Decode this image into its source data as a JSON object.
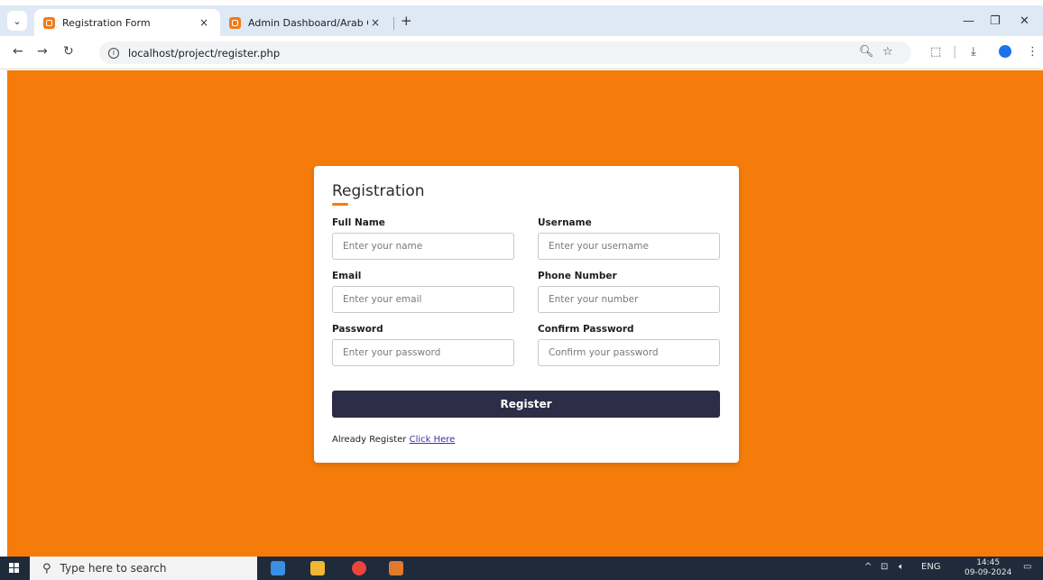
{
  "browser": {
    "tabs": [
      {
        "title": "Registration Form",
        "close": "×"
      },
      {
        "title": "Admin Dashboard/Arab Cars",
        "close": "×"
      }
    ],
    "new_tab": "+",
    "url": "localhost/project/register.php",
    "info_glyph": "i"
  },
  "form": {
    "title": "Registration",
    "fields": [
      {
        "label": "Full Name",
        "placeholder": "Enter your name"
      },
      {
        "label": "Username",
        "placeholder": "Enter your username"
      },
      {
        "label": "Email",
        "placeholder": "Enter your email"
      },
      {
        "label": "Phone Number",
        "placeholder": "Enter your number"
      },
      {
        "label": "Password",
        "placeholder": "Enter your password"
      },
      {
        "label": "Confirm Password",
        "placeholder": "Confirm your password"
      }
    ],
    "submit_label": "Register",
    "login_prompt": "Already Register",
    "login_link": "Click Here"
  },
  "taskbar": {
    "search_placeholder": "Type here to search",
    "language": "ENG",
    "time": "14:45",
    "date": "09-09-2024"
  },
  "colors": {
    "page_background": "#f57c0a",
    "button": "#2d2d48",
    "link": "#4a2ba8"
  }
}
